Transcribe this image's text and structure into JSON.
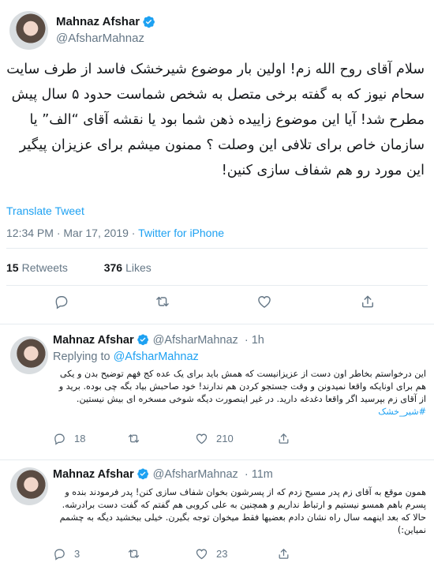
{
  "main_tweet": {
    "display_name": "Mahnaz Afshar",
    "handle": "@AfsharMahnaz",
    "text": "سلام آقای روح الله زم! اولین بار موضوع شیرخشک فاسد از طرف سایت سحام نیوز که به گفته برخی متصل به شخص شماست حدود ۵ سال پیش مطرح شد! آیا این موضوع زاییده ذهن شما بود یا نقشه آقای “الف” یا سازمان خاص برای تلافی این وصلت ؟ ممنون میشم برای عزیزان پیگیر این مورد رو هم شفاف سازی کنین!",
    "translate_label": "Translate Tweet",
    "time": "12:34 PM",
    "date": "Mar 17, 2019",
    "source": "Twitter for iPhone",
    "retweets_count": "15",
    "retweets_label": "Retweets",
    "likes_count": "376",
    "likes_label": "Likes"
  },
  "replies": [
    {
      "display_name": "Mahnaz Afshar",
      "handle": "@AfsharMahnaz",
      "time": "1h",
      "replying_prefix": "Replying to",
      "replying_to": "@AfsharMahnaz",
      "text": "این درخواستم بخاطر اون دست از عزیزانیست که همش باید برای یک عده کج فهم توضیح بدن و یکی هم برای اونایکه واقعا نمیدونن و وقت جستجو کردن هم ندارند! خود صاحبش بیاد بگه چی بوده. برید و از آقای زم بپرسید اگر واقعا دغدغه دارید. در غیر اینصورت دیگه شوخی مسخره ای بیش نیستین.",
      "hashtag": "#شیر_خشک",
      "replies": "18",
      "retweets": "",
      "likes": "210"
    },
    {
      "display_name": "Mahnaz Afshar",
      "handle": "@AfsharMahnaz",
      "time": "11m",
      "text": "همون موقع به آقای زم پدر مسیح زدم که از پسرشون بخوان شفاف سازی کنن! پدر فرمودند بنده و پسرم باهم همسو نیستیم و ارتباط نداریم و همچنین به علی کروبی هم گفتم که گفت دست برادرشه. حالا که بعد اینهمه سال راه نشان دادم بعضیها فقط میخوان توجه بگیرن. خیلی ببخشید دیگه به چشمم نمیاین:)",
      "replies": "3",
      "retweets": "",
      "likes": "23"
    }
  ],
  "colors": {
    "accent": "#1da1f2",
    "muted": "#657786",
    "text": "#14171a",
    "border": "#e6ecf0"
  },
  "icons": [
    "verified-badge-icon",
    "reply-icon",
    "retweet-icon",
    "like-icon",
    "share-icon"
  ]
}
